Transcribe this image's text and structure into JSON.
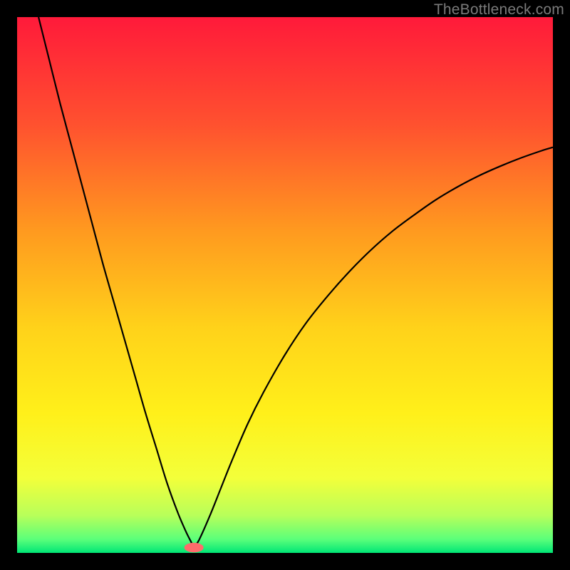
{
  "watermark": "TheBottleneck.com",
  "chart_data": {
    "type": "line",
    "title": "",
    "xlabel": "",
    "ylabel": "",
    "xlim": [
      0,
      100
    ],
    "ylim": [
      0,
      100
    ],
    "grid": false,
    "legend": false,
    "gradient_stops": [
      {
        "offset": 0.0,
        "color": "#ff1a3a"
      },
      {
        "offset": 0.2,
        "color": "#ff512f"
      },
      {
        "offset": 0.4,
        "color": "#ff9a1f"
      },
      {
        "offset": 0.58,
        "color": "#ffd21a"
      },
      {
        "offset": 0.74,
        "color": "#fff01a"
      },
      {
        "offset": 0.86,
        "color": "#f3ff3a"
      },
      {
        "offset": 0.93,
        "color": "#b8ff5a"
      },
      {
        "offset": 0.975,
        "color": "#5aff7a"
      },
      {
        "offset": 1.0,
        "color": "#00e676"
      }
    ],
    "green_band": {
      "y0": 96.5,
      "y1": 100
    },
    "marker": {
      "x": 33,
      "y": 99,
      "rx": 1.8,
      "ry": 0.9,
      "color": "#ff6b6b"
    },
    "series": [
      {
        "name": "left-branch",
        "x": [
          4,
          6,
          8,
          10,
          12,
          14,
          16,
          18,
          20,
          22,
          24,
          26,
          28,
          30,
          31.5,
          32.5,
          33
        ],
        "y": [
          0,
          8,
          16,
          23.5,
          31,
          38.5,
          46,
          53,
          60,
          67,
          74,
          80.5,
          87,
          92.5,
          96,
          98,
          99
        ]
      },
      {
        "name": "right-branch",
        "x": [
          33,
          34,
          36,
          38,
          40,
          43,
          46,
          50,
          54,
          58,
          62,
          66,
          70,
          74,
          78,
          82,
          86,
          90,
          94,
          98,
          100
        ],
        "y": [
          99,
          97.5,
          93,
          88,
          83,
          76,
          70,
          63,
          57,
          52,
          47.5,
          43.5,
          40,
          37,
          34.2,
          31.8,
          29.7,
          27.9,
          26.3,
          24.9,
          24.3
        ]
      }
    ]
  }
}
